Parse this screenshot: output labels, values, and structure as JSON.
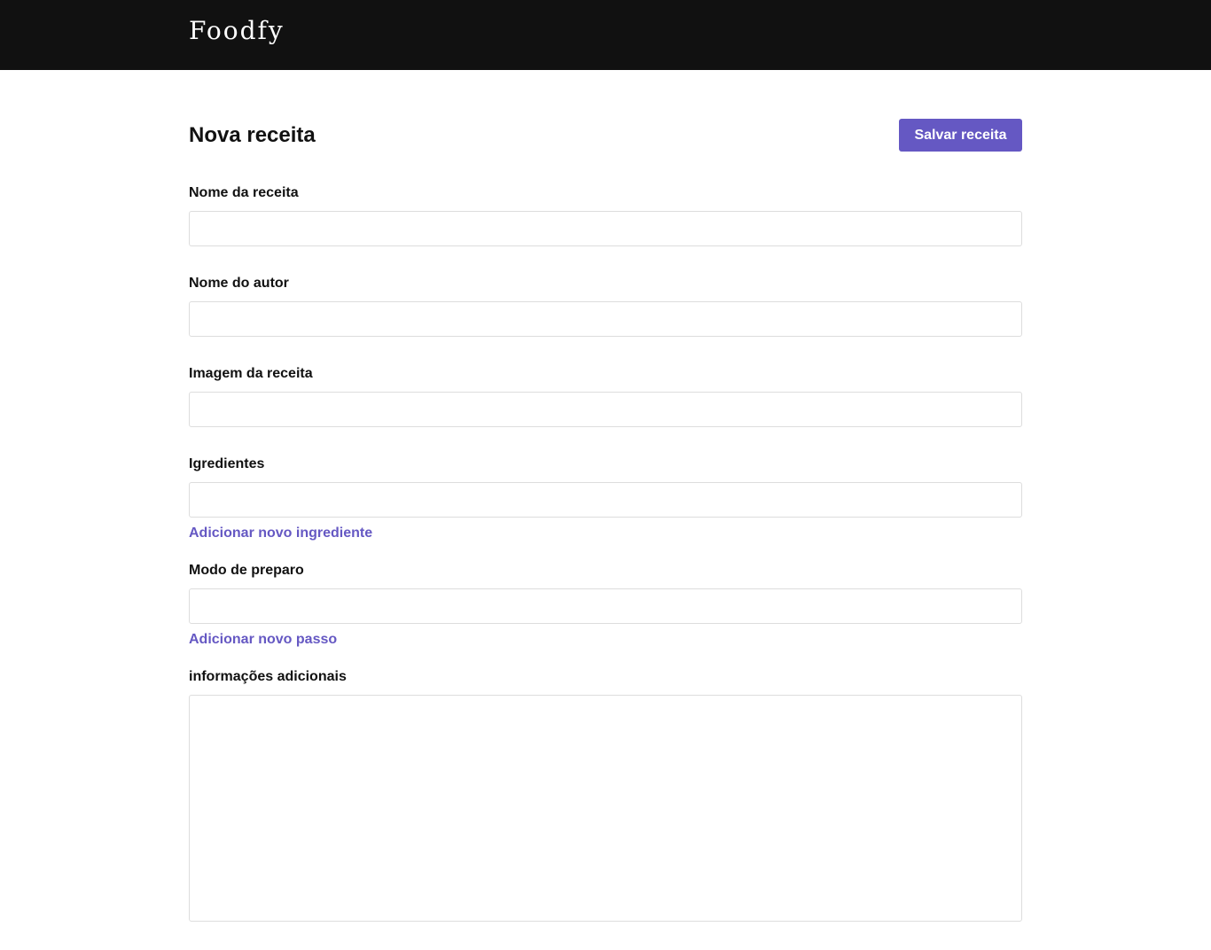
{
  "header": {
    "logo_text": "Foodfy",
    "background_color": "#111111"
  },
  "page": {
    "title": "Nova receita",
    "save_button_label": "Salvar receita",
    "accent_color": "#6558c3"
  },
  "form": {
    "recipe_name": {
      "label": "Nome da receita",
      "value": "",
      "placeholder": ""
    },
    "author_name": {
      "label": "Nome do autor",
      "value": "",
      "placeholder": ""
    },
    "recipe_image": {
      "label": "Imagem da receita",
      "value": "",
      "placeholder": ""
    },
    "ingredients": {
      "label": "Igredientes",
      "value": "",
      "placeholder": "",
      "add_link": "Adicionar novo ingrediente"
    },
    "preparation": {
      "label": "Modo de preparo",
      "value": "",
      "placeholder": "",
      "add_link": "Adicionar novo passo"
    },
    "additional_info": {
      "label": "informações adicionais",
      "value": "",
      "placeholder": ""
    }
  }
}
